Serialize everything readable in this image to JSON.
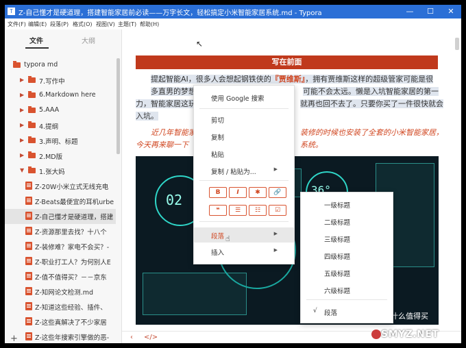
{
  "window": {
    "title": "Z-自己懂才是硬道理，搭建智能家居前必读——万字长文，轻松搞定小米智能家居系统.md - Typora",
    "app_icon": "T",
    "controls": {
      "minimize": "—",
      "maximize": "☐",
      "close": "✕"
    }
  },
  "menubar": [
    "文件(F)",
    "编辑(E)",
    "段落(P)",
    "格式(O)",
    "视图(V)",
    "主题(T)",
    "帮助(H)"
  ],
  "sidebar": {
    "tabs": [
      "文件",
      "大纲"
    ],
    "tree": [
      {
        "label": "typora md",
        "kind": "folder",
        "arrow": "▼",
        "level": 0
      },
      {
        "label": "7.写作中",
        "kind": "folder",
        "arrow": "▶",
        "level": 1
      },
      {
        "label": "6.Markdown here",
        "kind": "folder",
        "arrow": "▶",
        "level": 1
      },
      {
        "label": "5.AAA",
        "kind": "folder",
        "arrow": "▶",
        "level": 1
      },
      {
        "label": "4.提纲",
        "kind": "folder",
        "arrow": "▶",
        "level": 1
      },
      {
        "label": "3.声明、标题",
        "kind": "folder",
        "arrow": "▶",
        "level": 1
      },
      {
        "label": "2.MD版",
        "kind": "folder",
        "arrow": "▶",
        "level": 1
      },
      {
        "label": "1.张大妈",
        "kind": "folder",
        "arrow": "▼",
        "level": 1
      },
      {
        "label": "Z-20W小米立式无线充电",
        "kind": "doc",
        "level": 2
      },
      {
        "label": "Z-Beats最便宜的耳机urbe",
        "kind": "doc",
        "level": 2
      },
      {
        "label": "Z-自己懂才是硬道理，搭建",
        "kind": "doc",
        "level": 2,
        "selected": true
      },
      {
        "label": "Z-资源那里去找？十八个",
        "kind": "doc",
        "level": 2
      },
      {
        "label": "Z-装修难？家电不会买？-",
        "kind": "doc",
        "level": 2
      },
      {
        "label": "Z-职业打工人？为何别人E",
        "kind": "doc",
        "level": 2
      },
      {
        "label": "Z-值不值得买？－－京东",
        "kind": "doc",
        "level": 2
      },
      {
        "label": "Z-知网论文检测.md",
        "kind": "doc",
        "level": 2
      },
      {
        "label": "Z-知道这些经验、插件、",
        "kind": "doc",
        "level": 2
      },
      {
        "label": "Z-这些真解决了不少家居",
        "kind": "doc",
        "level": 2
      },
      {
        "label": "Z-这些年搜索引擎做的恶-",
        "kind": "doc",
        "level": 2
      }
    ],
    "add": "+"
  },
  "editor": {
    "banner": "写在前面",
    "para1_pre": "提起智能AI，很多人会想起钢铁侠的",
    "para1_red": "『贾维斯』",
    "para1_post": "，拥有贾维斯这样的超级管家可能是很多直男的梦想，",
    "para1_line2b": "可能不会太远。懒是入坑智能家居的第一动",
    "para1_line3a": "力，智能家居这玩",
    "para1_line3b": "就再也回不去了。只要你买了一件很快就会",
    "para1_line4": "入坑。",
    "para2_a": "近几年智能家",
    "para2_b": "装修的时候也安装了全套的小米智能家居，",
    "para2_c": "今天再来聊一下",
    "para2_d": "系统。",
    "figure_watermark": "什么值得买",
    "figure_clock": "02",
    "figure_temp": "36°",
    "bottom_left": "‹",
    "bottom_code": "</>"
  },
  "context_menu": {
    "search": "使用 Google 搜索",
    "cut": "剪切",
    "copy": "复制",
    "paste": "粘贴",
    "copy_paste_as": "复制 / 粘贴为...",
    "format_buttons": [
      "B",
      "I",
      "✱",
      "🔗"
    ],
    "list_buttons": [
      "❝",
      "☰",
      "☷",
      "☑"
    ],
    "paragraph": "段落",
    "insert": "插入",
    "submenu_arrow": "▶"
  },
  "submenu": {
    "items": [
      "一级标题",
      "二级标题",
      "三级标题",
      "四级标题",
      "五级标题",
      "六级标题"
    ],
    "checked_item": "段落",
    "check_mark": "√"
  },
  "site_watermark": "SMYZ.NET",
  "colors": {
    "accent": "#c0391c",
    "titlebar": "#2b6fd6",
    "icon_red": "#d9532f"
  }
}
